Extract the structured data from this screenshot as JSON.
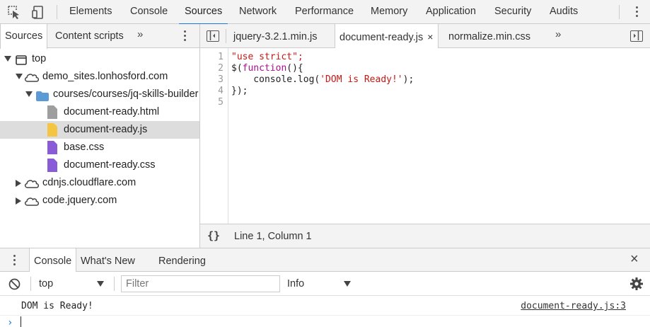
{
  "toolbar": {
    "tabs": [
      "Elements",
      "Console",
      "Sources",
      "Network",
      "Performance",
      "Memory",
      "Application",
      "Security",
      "Audits"
    ],
    "active_tab": "Sources"
  },
  "navigator": {
    "tabs": [
      "Sources",
      "Content scripts"
    ],
    "more_glyph": "»",
    "tree": [
      {
        "label": "top",
        "icon": "frame-icon"
      },
      {
        "label": "demo_sites.lonhosford.com",
        "icon": "cloud-icon"
      },
      {
        "label": "courses/courses/jq-skills-builder",
        "icon": "folder-icon"
      },
      {
        "label": "document-ready.html",
        "icon": "html-file-icon"
      },
      {
        "label": "document-ready.js",
        "icon": "js-file-icon"
      },
      {
        "label": "base.css",
        "icon": "css-file-icon"
      },
      {
        "label": "document-ready.css",
        "icon": "css-file-icon"
      },
      {
        "label": "cdnjs.cloudflare.com",
        "icon": "cloud-icon"
      },
      {
        "label": "code.jquery.com",
        "icon": "cloud-icon"
      }
    ]
  },
  "editor": {
    "tabs": [
      "jquery-3.2.1.min.js",
      "document-ready.js",
      "normalize.min.css"
    ],
    "active_tab": "document-ready.js",
    "close_glyph": "×",
    "more_glyph": "»",
    "line_numbers": [
      "1",
      "2",
      "3",
      "4",
      "5"
    ],
    "code": {
      "l1": "\"use strict\";",
      "l2a": "$(",
      "l2b": "function",
      "l2c": "(){",
      "l3a": "    console.log(",
      "l3b": "'DOM is Ready!'",
      "l3c": ");",
      "l4": "});"
    },
    "status": {
      "pretty_print": "{}",
      "position": "Line 1, Column 1"
    }
  },
  "drawer": {
    "tabs": [
      "Console",
      "What's New",
      "Rendering"
    ],
    "close_glyph": "×",
    "console": {
      "context": "top",
      "filter_placeholder": "Filter",
      "level": "Info",
      "messages": [
        {
          "text": "DOM is Ready!",
          "source": "document-ready.js:3"
        }
      ],
      "prompt_glyph": "›"
    }
  },
  "colors": {
    "accent": "#1a73e8",
    "string": "#c41a16",
    "keyword": "#aa0d91",
    "selected_row": "#dddddd"
  }
}
